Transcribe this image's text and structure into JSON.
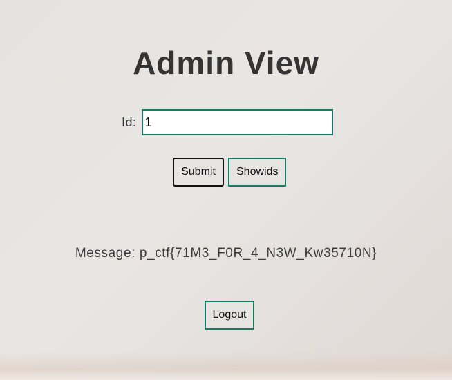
{
  "page": {
    "title": "Admin View"
  },
  "form": {
    "id_label": "Id:",
    "id_value": "1",
    "submit_label": "Submit",
    "showids_label": "Showids"
  },
  "message": {
    "text": "Message: p_ctf{71M3_F0R_4_N3W_Kw35710N}"
  },
  "logout_label": "Logout",
  "colors": {
    "accent_border": "#1a7a68",
    "title_text": "#343434",
    "background": "#e6e3e0"
  }
}
